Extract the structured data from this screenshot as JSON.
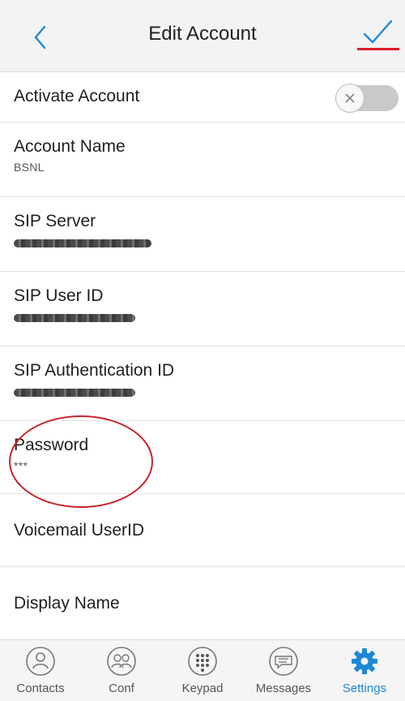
{
  "header": {
    "title": "Edit Account"
  },
  "colors": {
    "accent": "#1e88d6",
    "annotation_red": "#c8232b"
  },
  "rows": {
    "activate": {
      "label": "Activate Account",
      "toggle_on": false
    },
    "account_name": {
      "label": "Account Name",
      "value": "BSNL"
    },
    "sip_server": {
      "label": "SIP Server",
      "value_redacted": true
    },
    "sip_user_id": {
      "label": "SIP User ID",
      "value_redacted": true
    },
    "sip_auth_id": {
      "label": "SIP Authentication ID",
      "value_redacted": true
    },
    "password": {
      "label": "Password",
      "value": "***"
    },
    "voicemail": {
      "label": "Voicemail UserID"
    },
    "display_name": {
      "label": "Display Name"
    }
  },
  "tabs": [
    {
      "label": "Contacts",
      "icon": "contacts-icon",
      "active": false
    },
    {
      "label": "Conf",
      "icon": "conference-icon",
      "active": false
    },
    {
      "label": "Keypad",
      "icon": "keypad-icon",
      "active": false
    },
    {
      "label": "Messages",
      "icon": "messages-icon",
      "active": false
    },
    {
      "label": "Settings",
      "icon": "settings-gear-icon",
      "active": true
    }
  ]
}
